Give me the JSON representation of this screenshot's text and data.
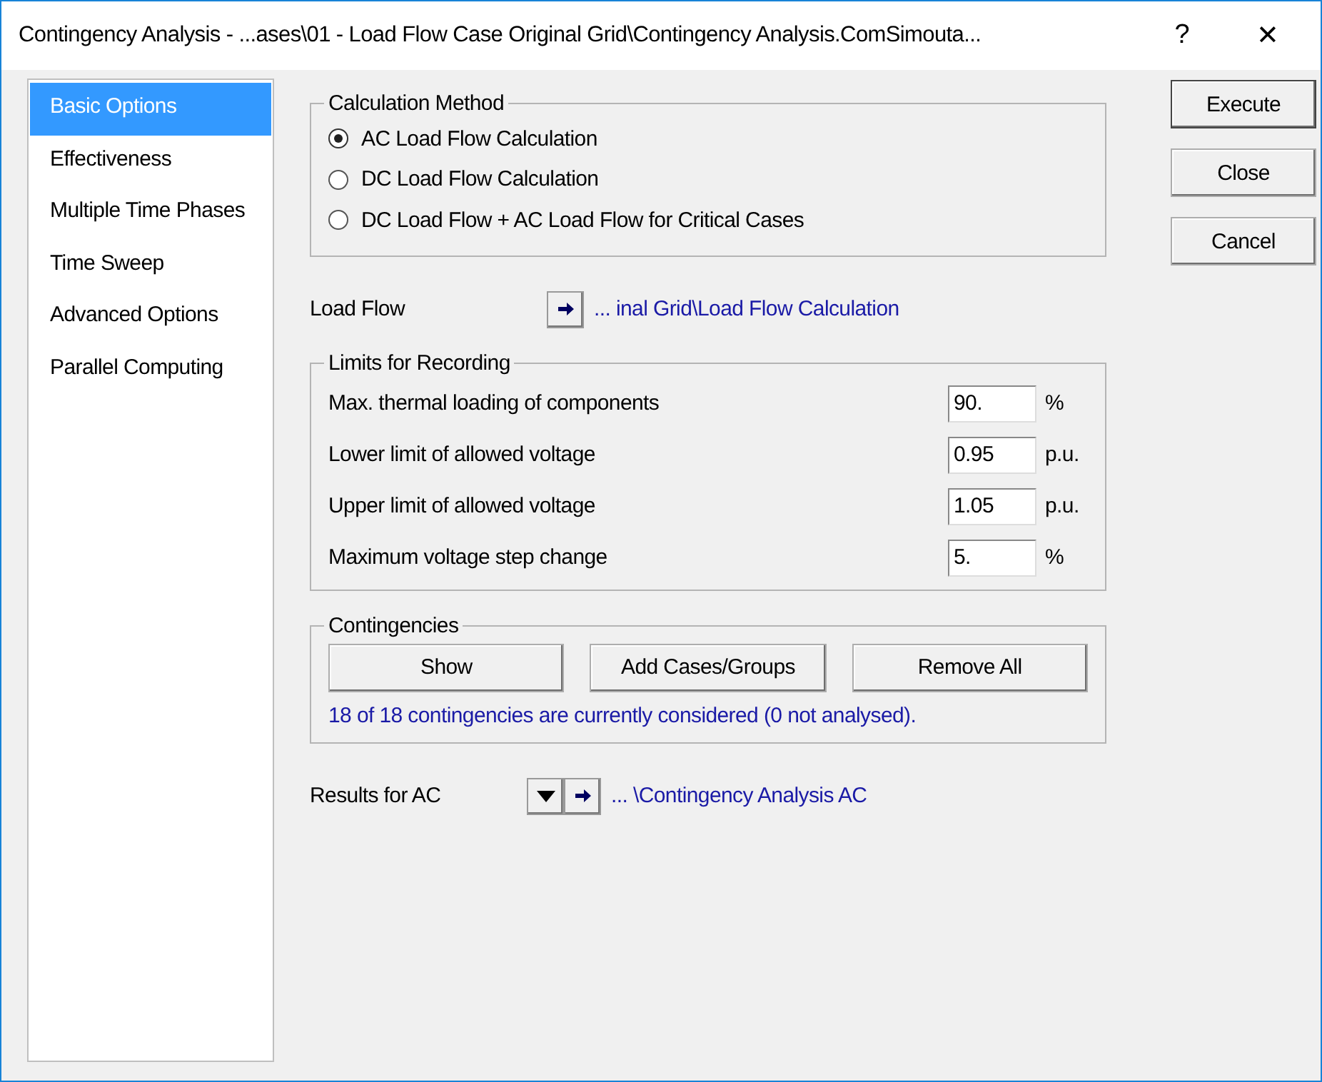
{
  "window": {
    "title": "Contingency Analysis - ...ases\\01 - Load Flow Case Original Grid\\Contingency Analysis.ComSimouta...",
    "help": "?",
    "close": "✕"
  },
  "sidebar": {
    "items": [
      {
        "label": "Basic Options",
        "selected": true
      },
      {
        "label": "Effectiveness",
        "selected": false
      },
      {
        "label": "Multiple Time Phases",
        "selected": false
      },
      {
        "label": "Time Sweep",
        "selected": false
      },
      {
        "label": "Advanced Options",
        "selected": false
      },
      {
        "label": "Parallel Computing",
        "selected": false
      }
    ]
  },
  "calculation_method": {
    "title": "Calculation Method",
    "options": [
      {
        "label": "AC Load Flow Calculation",
        "selected": true
      },
      {
        "label": "DC Load Flow Calculation",
        "selected": false
      },
      {
        "label": "DC Load Flow + AC Load Flow for Critical Cases",
        "selected": false
      }
    ]
  },
  "load_flow": {
    "label": "Load Flow",
    "link": "... inal Grid\\Load Flow Calculation"
  },
  "limits": {
    "title": "Limits for Recording",
    "rows": [
      {
        "label": "Max. thermal loading of components",
        "value": "90.",
        "unit": "%"
      },
      {
        "label": "Lower limit of allowed voltage",
        "value": "0.95",
        "unit": "p.u."
      },
      {
        "label": "Upper limit of allowed voltage",
        "value": "1.05",
        "unit": "p.u."
      },
      {
        "label": "Maximum voltage step change",
        "value": "5.",
        "unit": "%"
      }
    ]
  },
  "contingencies": {
    "title": "Contingencies",
    "buttons": [
      "Show",
      "Add Cases/Groups",
      "Remove All"
    ],
    "status": "18 of 18 contingencies are currently considered (0 not analysed)."
  },
  "results": {
    "label": "Results for AC",
    "link": "... \\Contingency Analysis AC"
  },
  "buttons": [
    "Execute",
    "Close",
    "Cancel"
  ]
}
